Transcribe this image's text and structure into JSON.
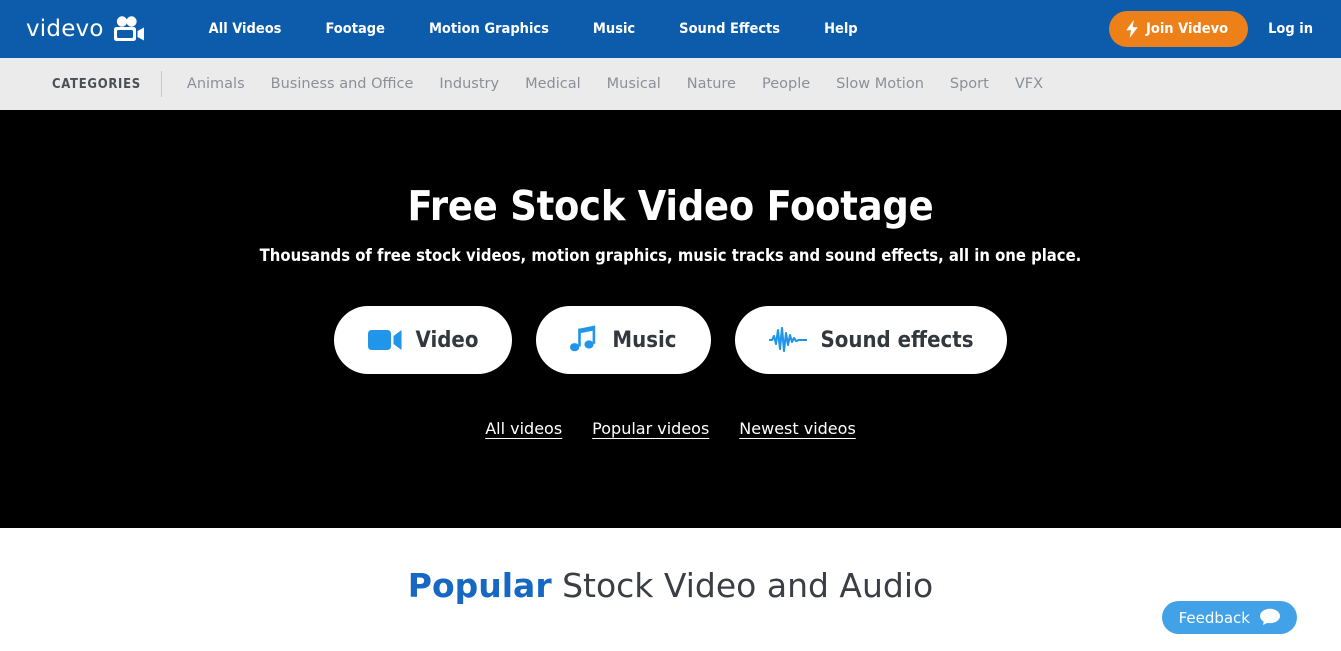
{
  "brand": {
    "name": "videvo",
    "logo_icon": "movie-camera-icon"
  },
  "colors": {
    "nav_blue": "#0d5cab",
    "join_orange": "#ee8019",
    "icon_blue": "#2196e8",
    "accent_blue": "#1668c2",
    "feedback_blue": "#42a2e8",
    "categories_bg": "#ebebeb",
    "hero_bg": "#000000"
  },
  "nav": {
    "links": [
      {
        "label": "All Videos"
      },
      {
        "label": "Footage"
      },
      {
        "label": "Motion Graphics"
      },
      {
        "label": "Music"
      },
      {
        "label": "Sound Effects"
      },
      {
        "label": "Help"
      }
    ],
    "join_label": "Join Videvo",
    "join_icon": "lightning-bolt-icon",
    "login_label": "Log in"
  },
  "categories": {
    "label": "CATEGORIES",
    "items": [
      {
        "label": "Animals"
      },
      {
        "label": "Business and Office"
      },
      {
        "label": "Industry"
      },
      {
        "label": "Medical"
      },
      {
        "label": "Musical"
      },
      {
        "label": "Nature"
      },
      {
        "label": "People"
      },
      {
        "label": "Slow Motion"
      },
      {
        "label": "Sport"
      },
      {
        "label": "VFX"
      }
    ]
  },
  "hero": {
    "title": "Free Stock Video Footage",
    "subtitle": "Thousands of free stock videos, motion graphics, music tracks and sound effects, all in one place.",
    "pills": [
      {
        "label": "Video",
        "icon": "video-camera-icon"
      },
      {
        "label": "Music",
        "icon": "music-note-icon"
      },
      {
        "label": "Sound effects",
        "icon": "waveform-icon"
      }
    ],
    "links": [
      {
        "label": "All videos"
      },
      {
        "label": "Popular videos"
      },
      {
        "label": "Newest videos"
      }
    ]
  },
  "popular": {
    "accent_word": "Popular",
    "rest_text": " Stock Video and Audio"
  },
  "feedback": {
    "label": "Feedback",
    "icon": "speech-bubble-icon"
  }
}
